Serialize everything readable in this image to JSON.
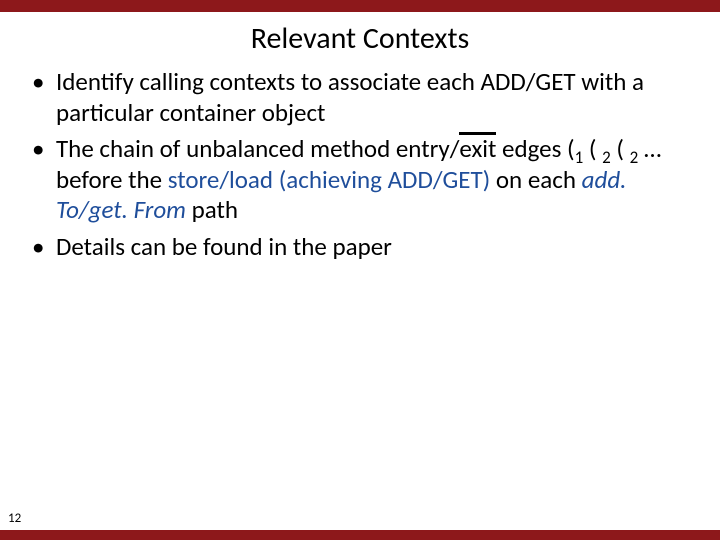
{
  "title": "Relevant Contexts",
  "bullets": {
    "b1": "Identify calling contexts to associate each ADD/GET with a particular container object",
    "b2": {
      "pre": "The chain of unbalanced method entry/",
      "over": "exit",
      "mid1": " edges (",
      "s1": "1",
      "paren2": " ( ",
      "s2": "2",
      "paren3": " ( ",
      "s3": "2",
      "dots": " … before the ",
      "hl1": "store/load (achieving ADD/GET)",
      "mid2": " on each ",
      "hl2": "add. To/get. From",
      "tail": " path"
    },
    "b3": "Details can be found in the paper"
  },
  "page_number": "12"
}
